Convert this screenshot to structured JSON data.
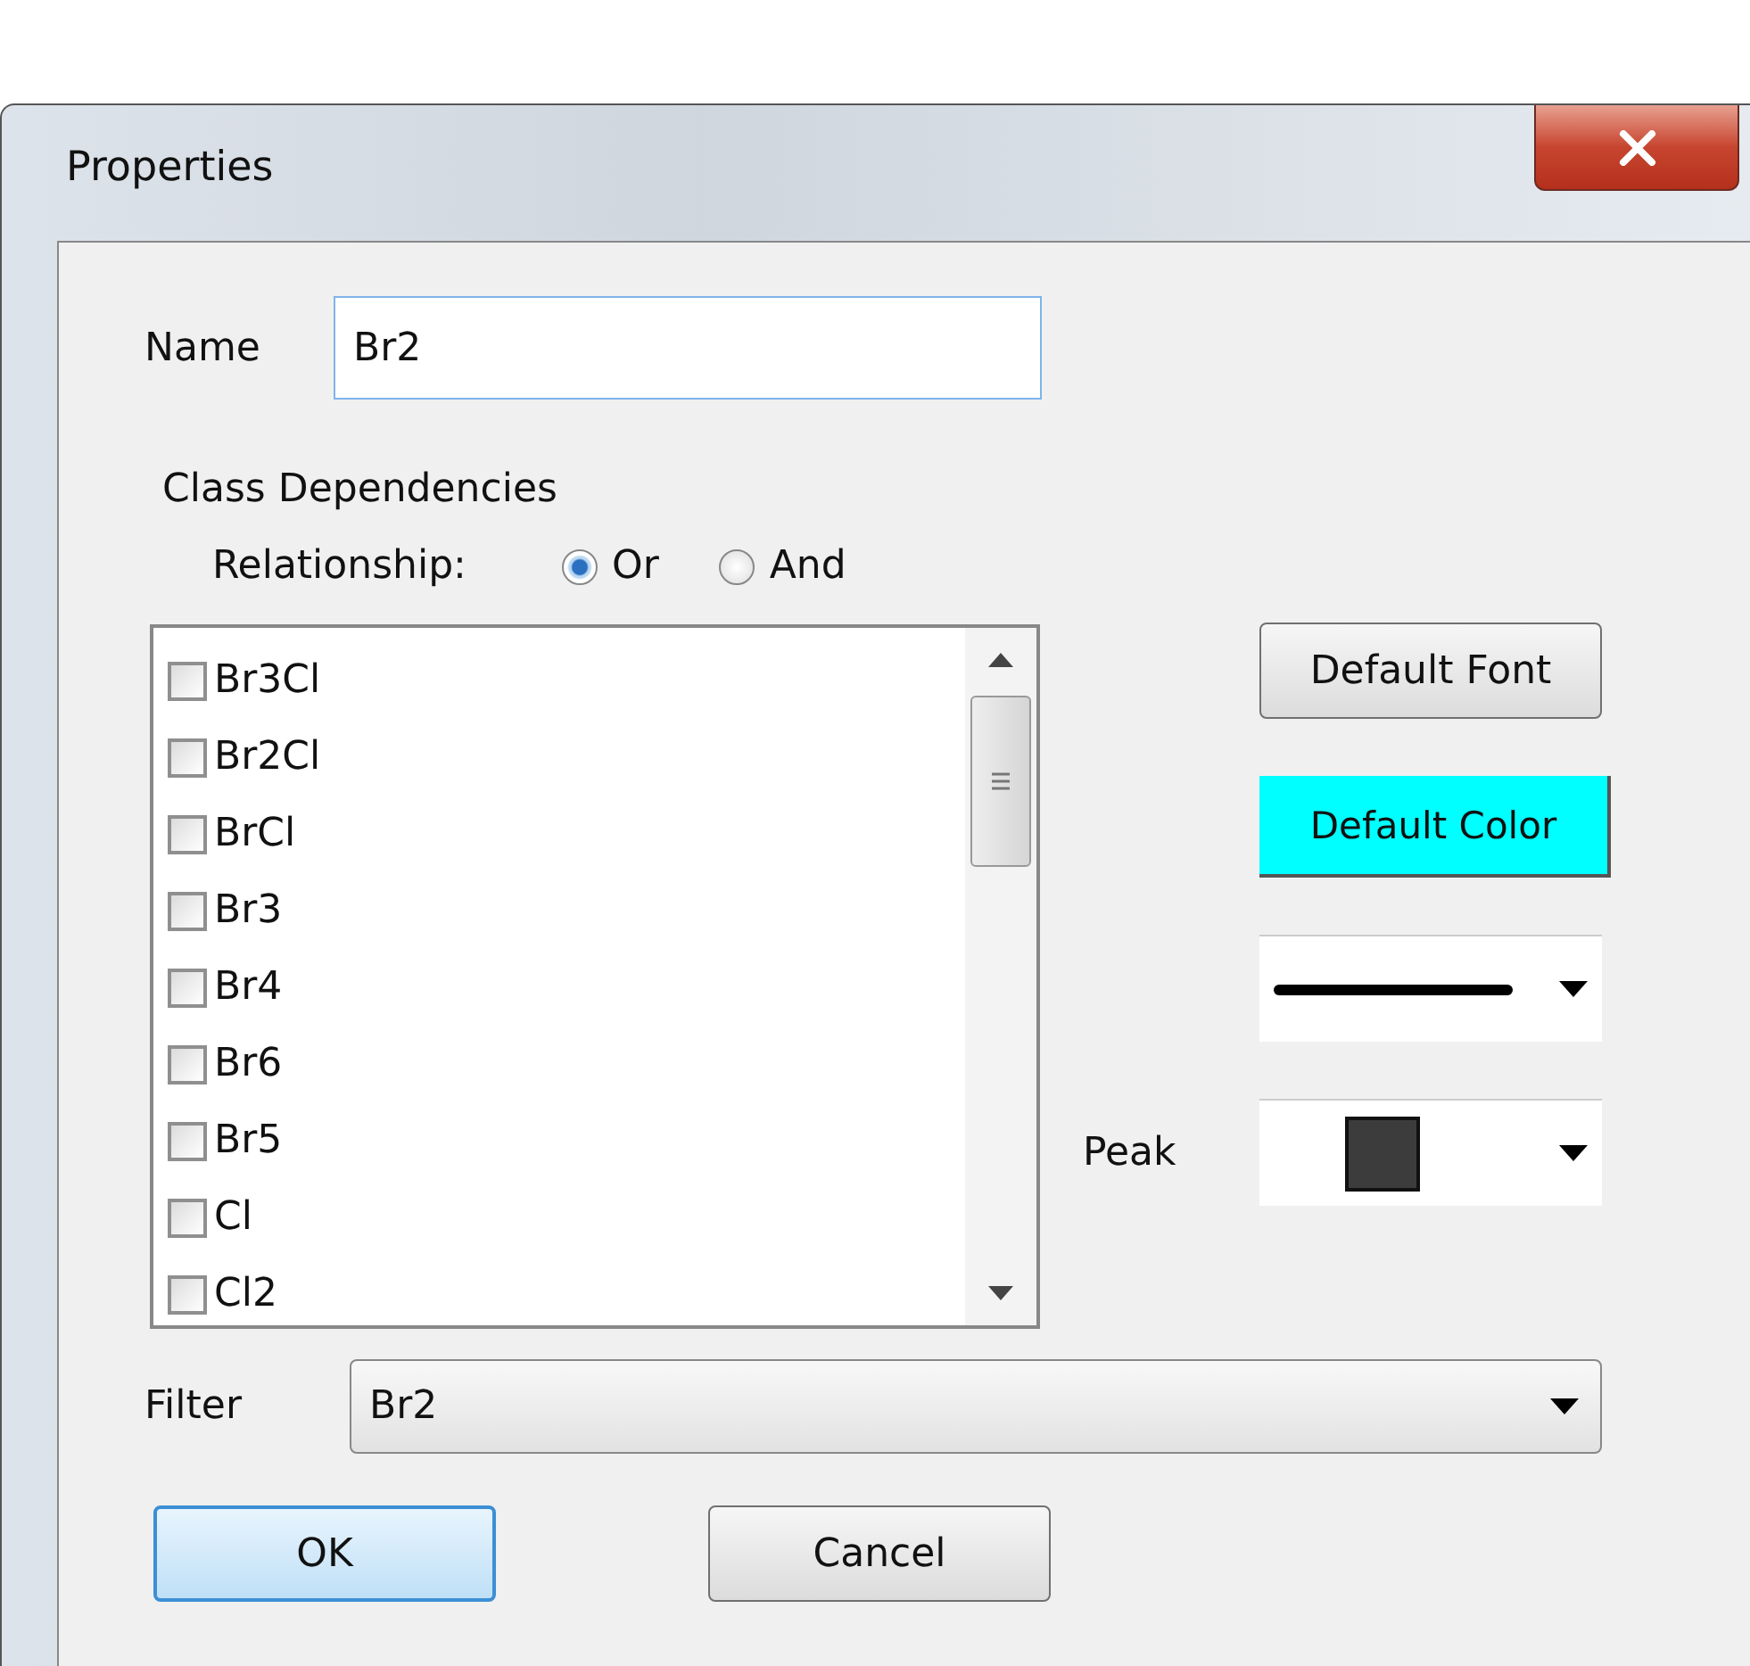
{
  "window": {
    "title": "Properties"
  },
  "name_field": {
    "label": "Name",
    "value": "Br2"
  },
  "class_dependencies": {
    "heading": "Class Dependencies",
    "relationship_label": "Relationship:",
    "options": [
      {
        "label": "Or",
        "selected": true
      },
      {
        "label": "And",
        "selected": false
      }
    ],
    "items": [
      {
        "label": "Br3Cl",
        "checked": false
      },
      {
        "label": "Br2Cl",
        "checked": false
      },
      {
        "label": "BrCl",
        "checked": false
      },
      {
        "label": "Br3",
        "checked": false
      },
      {
        "label": "Br4",
        "checked": false
      },
      {
        "label": "Br6",
        "checked": false
      },
      {
        "label": "Br5",
        "checked": false
      },
      {
        "label": "Cl",
        "checked": false
      },
      {
        "label": "Cl2",
        "checked": false
      }
    ]
  },
  "default_font_button": {
    "label": "Default Font"
  },
  "default_color_button": {
    "label": "Default Color",
    "color": "#00ffff"
  },
  "style_pickers": [
    {
      "kind": "line"
    },
    {
      "kind": "marker",
      "label": "Peak"
    }
  ],
  "filter": {
    "label": "Filter",
    "value": "Br2"
  },
  "buttons": [
    {
      "label": "OK",
      "selected": true
    },
    {
      "label": "Cancel",
      "selected": false
    }
  ]
}
